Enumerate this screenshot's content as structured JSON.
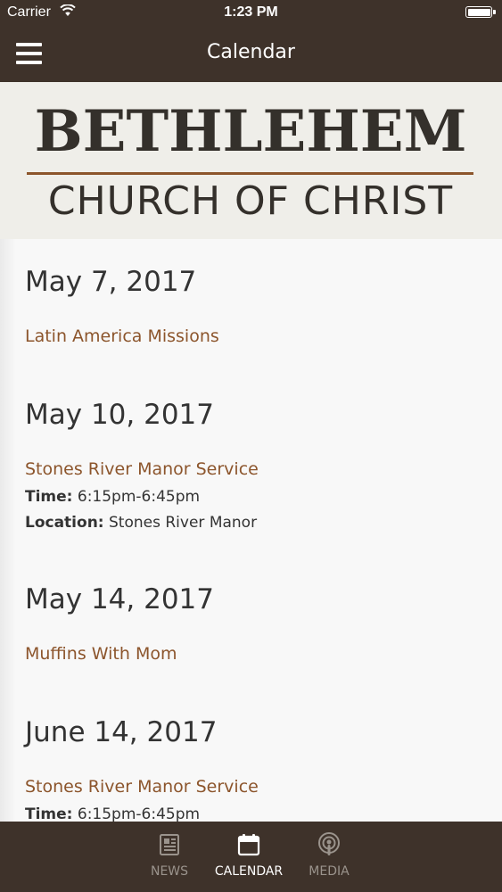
{
  "status_bar": {
    "carrier": "Carrier",
    "time": "1:23 PM",
    "battery_level": 1.0
  },
  "nav": {
    "title": "Calendar"
  },
  "banner": {
    "line1": "BETHLEHEM",
    "line2": "CHURCH OF CHRIST"
  },
  "events": [
    {
      "date": "May 7, 2017",
      "title": "Latin America Missions"
    },
    {
      "date": "May 10, 2017",
      "title": "Stones River Manor Service",
      "time_label": "Time:",
      "time": "6:15pm-6:45pm",
      "location_label": "Location:",
      "location": "Stones River Manor"
    },
    {
      "date": "May 14, 2017",
      "title": "Muffins With Mom"
    },
    {
      "date": "June 14, 2017",
      "title": "Stones River Manor Service",
      "time_label": "Time:",
      "time": "6:15pm-6:45pm"
    }
  ],
  "tabs": [
    {
      "label": "NEWS",
      "icon": "newspaper-icon",
      "active": false
    },
    {
      "label": "CALENDAR",
      "icon": "calendar-icon",
      "active": true
    },
    {
      "label": "MEDIA",
      "icon": "podcast-icon",
      "active": false
    }
  ],
  "colors": {
    "bar_background": "#3e322a",
    "accent": "#8c552c",
    "content_background": "#f8f8f8",
    "text": "#333333"
  }
}
